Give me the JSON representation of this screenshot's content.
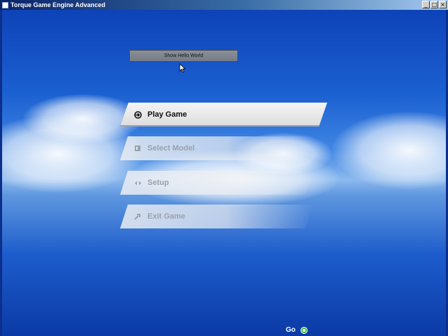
{
  "window": {
    "title": "Torque Game Engine Advanced",
    "controls": {
      "minimize": "_",
      "maximize": "□",
      "close": "×"
    }
  },
  "hello_button": {
    "label": "Show Hello World"
  },
  "menu": [
    {
      "label": "Play Game",
      "icon": "play-arrow-icon",
      "state": "active"
    },
    {
      "label": "Select Model",
      "icon": "model-icon",
      "state": "inactive"
    },
    {
      "label": "Setup",
      "icon": "setup-icon",
      "state": "inactive"
    },
    {
      "label": "Exit Game",
      "icon": "exit-icon",
      "state": "inactive"
    }
  ],
  "go": {
    "label": "Go",
    "color": "#3fbf3f"
  },
  "colors": {
    "titlebar": "#0a246a",
    "sky": "#1a5fd0",
    "accent_active": "#ffffff"
  }
}
